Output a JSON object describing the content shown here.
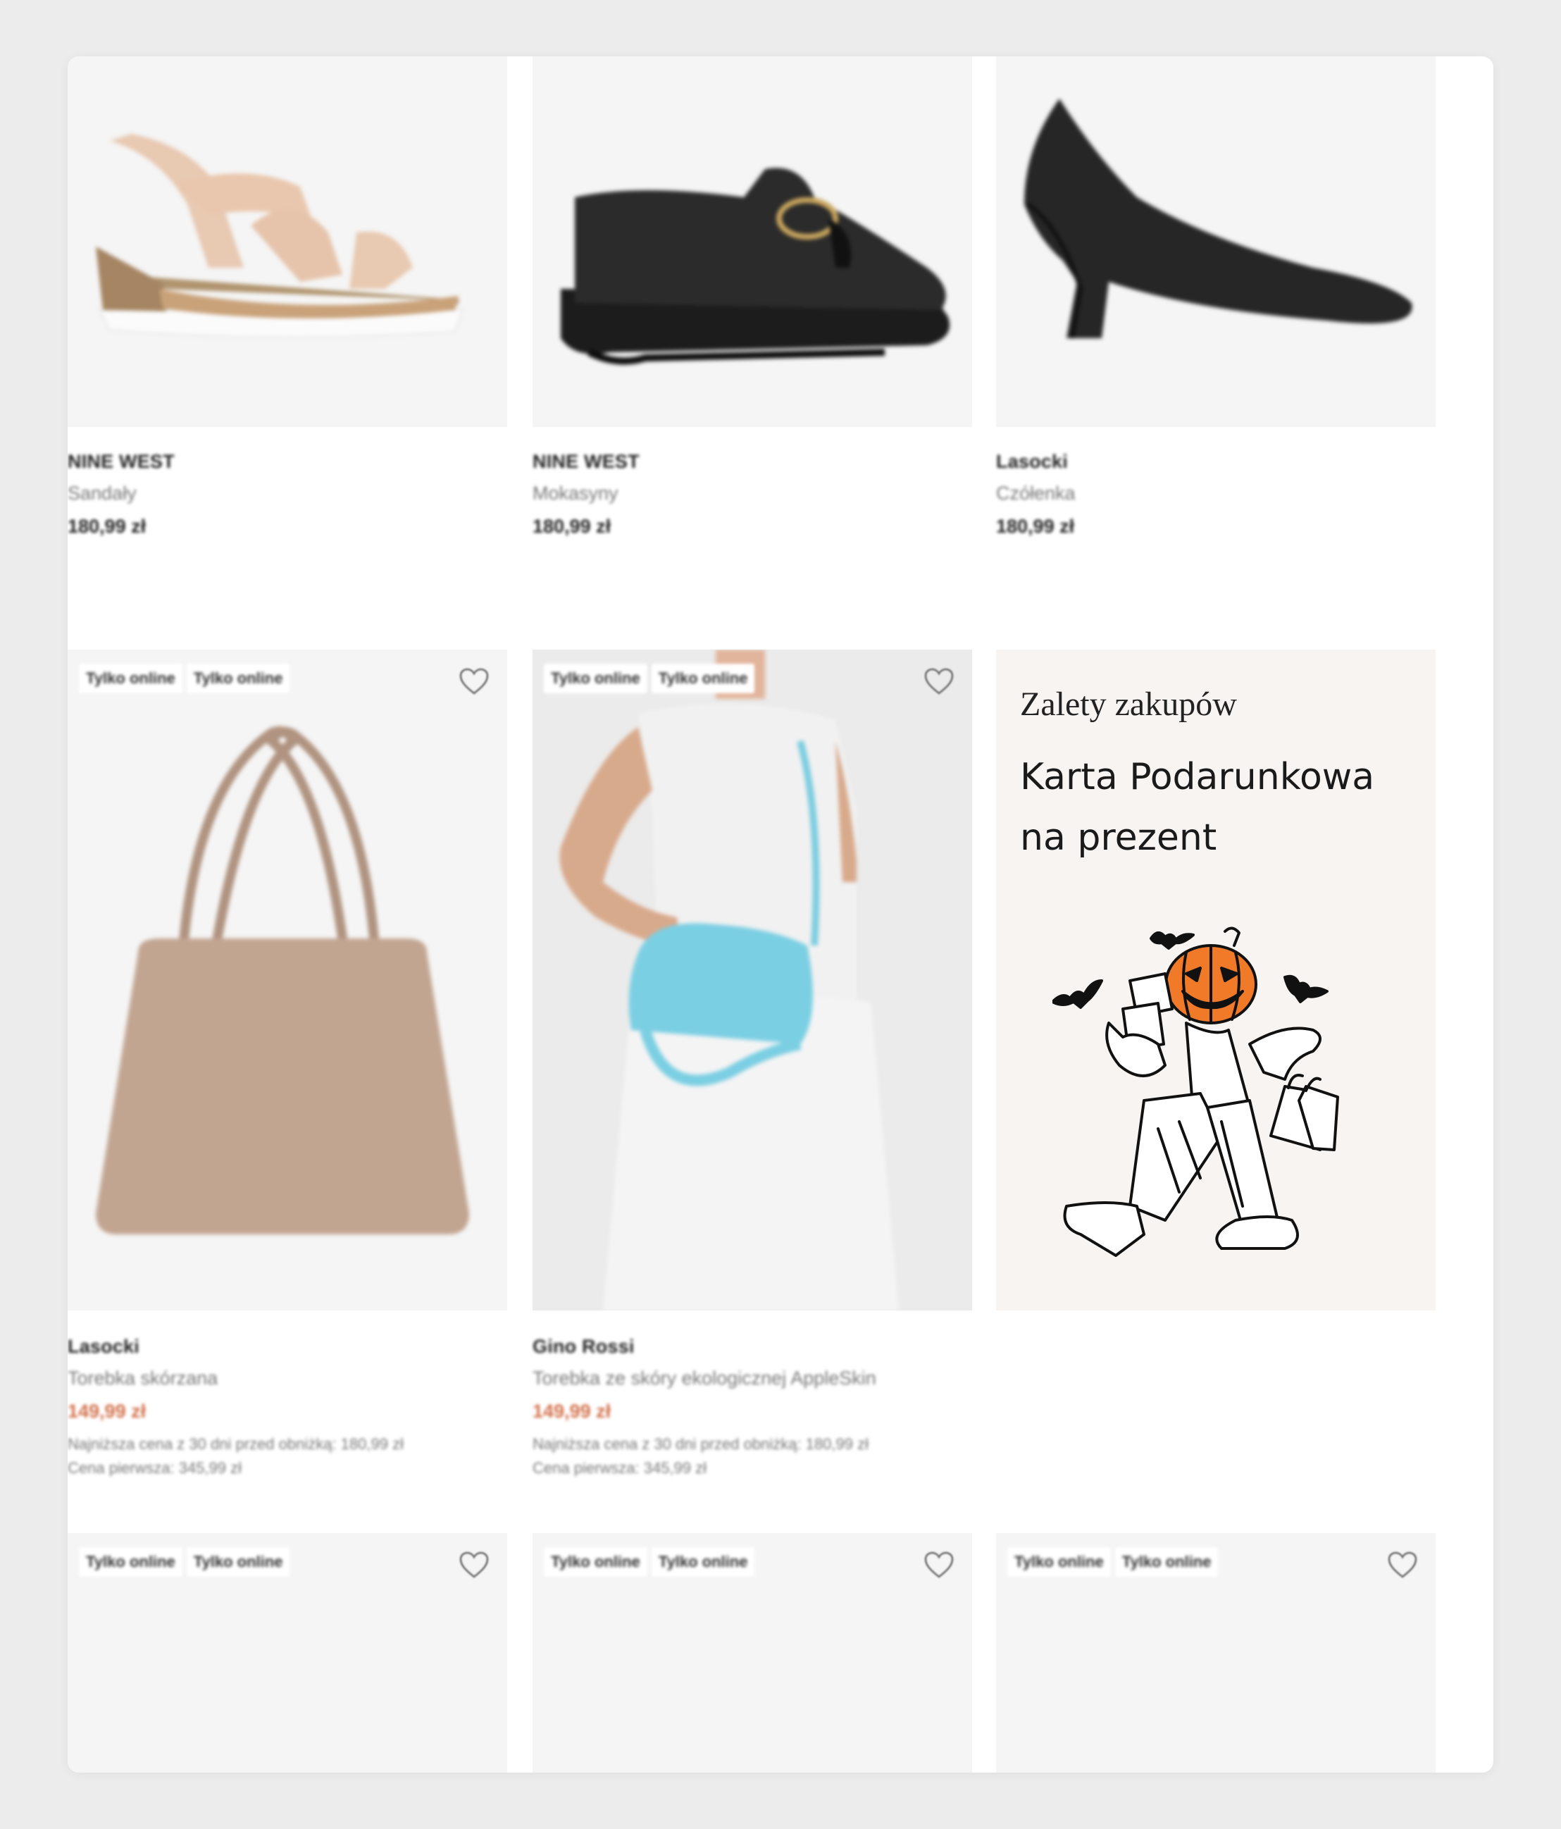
{
  "row1": [
    {
      "brand": "NINE WEST",
      "category": "Sandały",
      "price": "180,99 zł",
      "image": "sandal-image"
    },
    {
      "brand": "NINE WEST",
      "category": "Mokasyny",
      "price": "180,99 zł",
      "image": "loafer-image"
    },
    {
      "brand": "Lasocki",
      "category": "Czółenka",
      "price": "180,99 zł",
      "image": "pump-image"
    }
  ],
  "row2": [
    {
      "badges": [
        "Tylko online",
        "Tylko online"
      ],
      "brand": "Lasocki",
      "category": "Torebka skórzana",
      "price": "149,99 zł",
      "lowest_price": "Najniższa cena z 30 dni przed obniżką: 180,99 zł",
      "first_price": "Cena pierwsza: 345,99 zł",
      "image": "tote-bag-image"
    },
    {
      "badges": [
        "Tylko online",
        "Tylko online"
      ],
      "brand": "Gino Rossi",
      "category": "Torebka ze skóry ekologicznej AppleSkin",
      "price": "149,99 zł",
      "lowest_price": "Najniższa cena z 30 dni przed obniżką: 180,99 zł",
      "first_price": "Cena pierwsza: 345,99 zł",
      "image": "model-with-blue-bag-image"
    }
  ],
  "promo": {
    "kicker": "Zalety zakupów",
    "title": "Karta Podarunkowa na prezent",
    "illustration": "halloween-pumpkin-shopper-illustration"
  },
  "row3": [
    {
      "badges": [
        "Tylko online",
        "Tylko online"
      ]
    },
    {
      "badges": [
        "Tylko online",
        "Tylko online"
      ]
    },
    {
      "badges": [
        "Tylko online",
        "Tylko online"
      ]
    }
  ],
  "icons": {
    "wishlist": "heart-icon"
  },
  "colors": {
    "sale_price": "#d2704a",
    "tile_bg": "#f5f5f5",
    "promo_bg": "#f7f4f1",
    "pumpkin": "#f07a28"
  }
}
